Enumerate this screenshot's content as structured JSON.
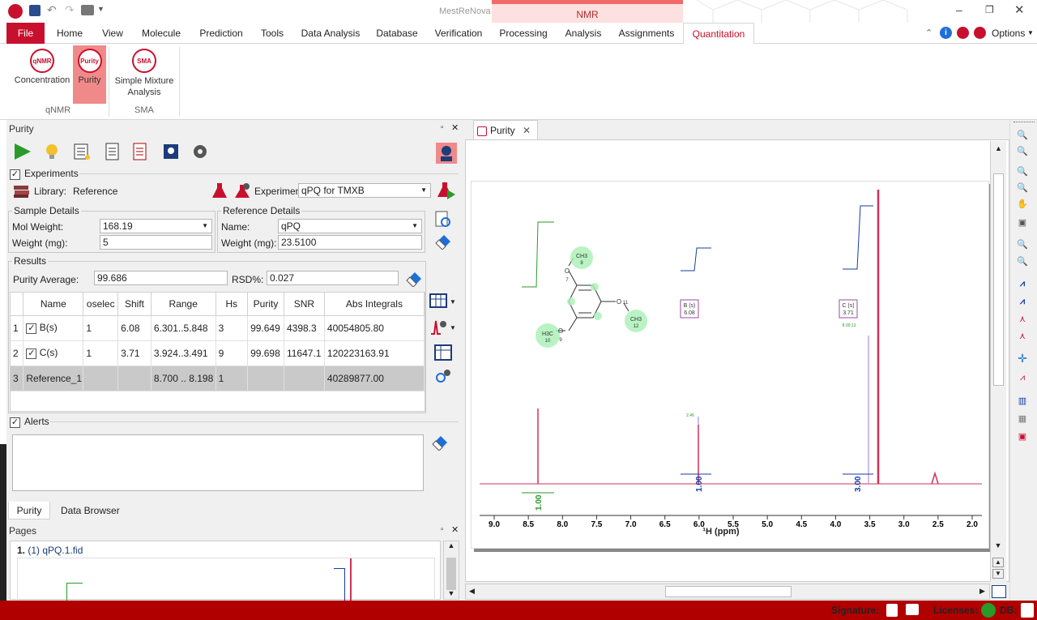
{
  "app": {
    "title": "MestReNova",
    "context_tab": "NMR"
  },
  "menu": {
    "file": "File",
    "tabs": [
      "Home",
      "View",
      "Molecule",
      "Prediction",
      "Tools",
      "Data Analysis",
      "Database",
      "Verification",
      "Processing",
      "Analysis",
      "Assignments",
      "Quantitation"
    ],
    "options": "Options"
  },
  "ribbon": {
    "concentration": "Concentration",
    "purity": "Purity",
    "sma": "Simple Mixture Analysis",
    "group_qnmr": "qNMR",
    "group_sma": "SMA",
    "icon_qnmr": "qNMR",
    "icon_purity": "Purity",
    "icon_sma": "SMA"
  },
  "purity_panel": {
    "title": "Purity",
    "experiments_label": "Experiments",
    "library_label": "Library:",
    "library_value": "Reference",
    "experiment_label": "Experimen",
    "experiment_value": "qPQ for TMXB",
    "sample": {
      "title": "Sample Details",
      "mol_weight_label": "Mol Weight:",
      "mol_weight": "168.19",
      "weight_label": "Weight (mg):",
      "weight": "5"
    },
    "reference": {
      "title": "Reference Details",
      "name_label": "Name:",
      "name": "qPQ",
      "weight_label": "Weight (mg):",
      "weight": "23.5100"
    },
    "results": {
      "title": "Results",
      "purity_avg_label": "Purity Average:",
      "purity_avg": "99.686",
      "rsd_label": "RSD%:",
      "rsd": "0.027",
      "columns": [
        "Name",
        "oselec",
        "Shift",
        "Range",
        "Hs",
        "Purity",
        "SNR",
        "Abs Integrals"
      ],
      "rows": [
        {
          "idx": "1",
          "name": "B(s)",
          "checked": true,
          "sel": "1",
          "shift": "6.08",
          "range": "6.301..5.848",
          "hs": "3",
          "purity": "99.649",
          "snr": "4398.3",
          "abs": "40054805.80"
        },
        {
          "idx": "2",
          "name": "C(s)",
          "checked": true,
          "sel": "1",
          "shift": "3.71",
          "range": "3.924..3.491",
          "hs": "9",
          "purity": "99.698",
          "snr": "11647.1",
          "abs": "120223163.91"
        },
        {
          "idx": "3",
          "name": "Reference_1",
          "checked": false,
          "sel": "",
          "shift": "",
          "range": "8.700 .. 8.198",
          "hs": "1",
          "purity": "",
          "snr": "",
          "abs": "40289877.00"
        }
      ]
    },
    "alerts_label": "Alerts",
    "bottom_tabs": [
      "Purity",
      "Data Browser"
    ]
  },
  "pages_panel": {
    "title": "Pages",
    "item": "(1) qPQ.1.fid",
    "item_num": "1."
  },
  "document": {
    "tab": "Purity",
    "x_axis_label": "¹H (ppm)",
    "ticks": [
      "9.0",
      "8.5",
      "8.0",
      "7.5",
      "7.0",
      "6.5",
      "6.0",
      "5.5",
      "5.0",
      "4.5",
      "4.0",
      "3.5",
      "3.0",
      "2.5",
      "2.0"
    ],
    "peak_label_b": "B (s)",
    "peak_val_b": "6.08",
    "peak_label_c": "C (s)",
    "peak_val_c": "3.71",
    "integrals": [
      "1.00",
      "1.00",
      "3.00"
    ],
    "mol_labels": {
      "ch3_top": "CH3",
      "ch3_top_n": "8",
      "o7": "O",
      "o7_n": "7",
      "ch3_right": "CH3",
      "ch3_right_n": "12",
      "o11": "O",
      "o11_n": "11",
      "h3c": "H3C",
      "h3c_n": "10",
      "o9": "O",
      "o9_n": "9"
    },
    "small_labels": [
      "2.46",
      "8.00;13"
    ]
  },
  "status": {
    "signature": "Signature:",
    "licenses": "Licenses:",
    "db": "DB:"
  },
  "colors": {
    "brand": "#c8102e",
    "status_bg": "#b00000",
    "spectrum": "#d4305a",
    "integral_blue": "#1a3aaa",
    "integral_green": "#2a9a2a"
  }
}
